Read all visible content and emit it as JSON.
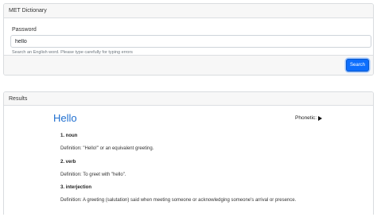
{
  "search_card": {
    "header": "MET Dictionary",
    "field_label": "Password",
    "input_value": "hello",
    "help_text": "Search an English word. Please type carefully for typing errors",
    "search_button": "Search"
  },
  "results_card": {
    "header": "Results",
    "word": "Hello",
    "phonetic_label": "Phonetic:",
    "senses": [
      {
        "pos": "1. noun",
        "definition": "Definition: \"Hello!\" or an equivalent greeting."
      },
      {
        "pos": "2. verb",
        "definition": "Definition: To greet with \"hello\"."
      },
      {
        "pos": "3. interjection",
        "definition": "Definition: A greeting (salutation) said when meeting someone or acknowledging someone's arrival or presence."
      }
    ]
  },
  "colors": {
    "accent": "#0d6efd",
    "word_color": "#1f6fd0"
  },
  "icons": [
    "play-icon"
  ]
}
